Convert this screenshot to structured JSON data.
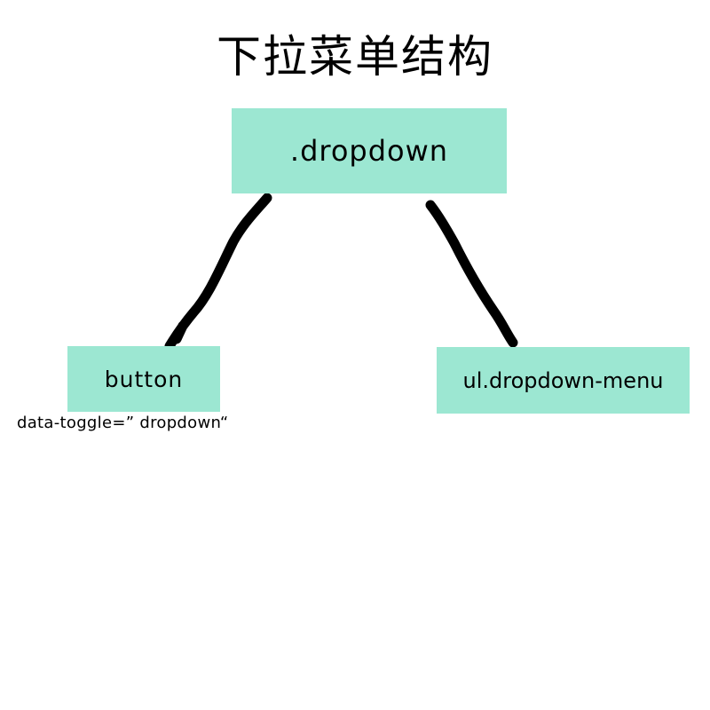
{
  "title": "下拉菜单结构",
  "colors": {
    "node_fill": "#9ce7d2",
    "line": "#000000",
    "text": "#000000",
    "background": "#ffffff"
  },
  "nodes": {
    "root": {
      "label": ".dropdown"
    },
    "button": {
      "label": "button",
      "caption": "data-toggle=” dropdown“"
    },
    "menu": {
      "label": "ul.dropdown-menu"
    }
  },
  "edges": [
    {
      "from": "root",
      "to": "button"
    },
    {
      "from": "root",
      "to": "menu"
    }
  ]
}
